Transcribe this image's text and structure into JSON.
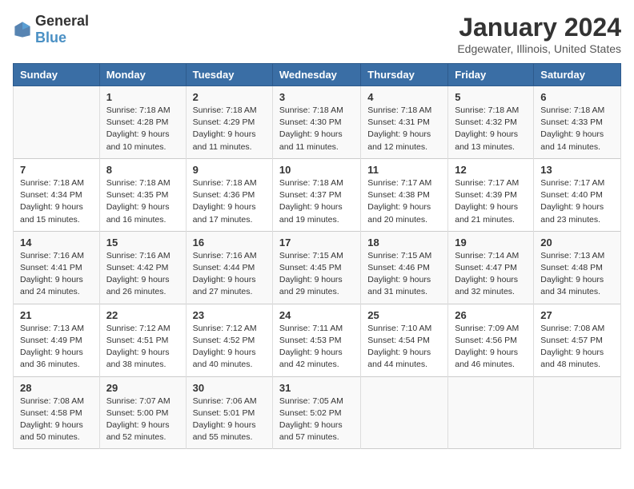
{
  "header": {
    "logo_general": "General",
    "logo_blue": "Blue",
    "title": "January 2024",
    "subtitle": "Edgewater, Illinois, United States"
  },
  "days_of_week": [
    "Sunday",
    "Monday",
    "Tuesday",
    "Wednesday",
    "Thursday",
    "Friday",
    "Saturday"
  ],
  "weeks": [
    [
      {
        "day": "",
        "sunrise": "",
        "sunset": "",
        "daylight": ""
      },
      {
        "day": "1",
        "sunrise": "Sunrise: 7:18 AM",
        "sunset": "Sunset: 4:28 PM",
        "daylight": "Daylight: 9 hours and 10 minutes."
      },
      {
        "day": "2",
        "sunrise": "Sunrise: 7:18 AM",
        "sunset": "Sunset: 4:29 PM",
        "daylight": "Daylight: 9 hours and 11 minutes."
      },
      {
        "day": "3",
        "sunrise": "Sunrise: 7:18 AM",
        "sunset": "Sunset: 4:30 PM",
        "daylight": "Daylight: 9 hours and 11 minutes."
      },
      {
        "day": "4",
        "sunrise": "Sunrise: 7:18 AM",
        "sunset": "Sunset: 4:31 PM",
        "daylight": "Daylight: 9 hours and 12 minutes."
      },
      {
        "day": "5",
        "sunrise": "Sunrise: 7:18 AM",
        "sunset": "Sunset: 4:32 PM",
        "daylight": "Daylight: 9 hours and 13 minutes."
      },
      {
        "day": "6",
        "sunrise": "Sunrise: 7:18 AM",
        "sunset": "Sunset: 4:33 PM",
        "daylight": "Daylight: 9 hours and 14 minutes."
      }
    ],
    [
      {
        "day": "7",
        "sunrise": "Sunrise: 7:18 AM",
        "sunset": "Sunset: 4:34 PM",
        "daylight": "Daylight: 9 hours and 15 minutes."
      },
      {
        "day": "8",
        "sunrise": "Sunrise: 7:18 AM",
        "sunset": "Sunset: 4:35 PM",
        "daylight": "Daylight: 9 hours and 16 minutes."
      },
      {
        "day": "9",
        "sunrise": "Sunrise: 7:18 AM",
        "sunset": "Sunset: 4:36 PM",
        "daylight": "Daylight: 9 hours and 17 minutes."
      },
      {
        "day": "10",
        "sunrise": "Sunrise: 7:18 AM",
        "sunset": "Sunset: 4:37 PM",
        "daylight": "Daylight: 9 hours and 19 minutes."
      },
      {
        "day": "11",
        "sunrise": "Sunrise: 7:17 AM",
        "sunset": "Sunset: 4:38 PM",
        "daylight": "Daylight: 9 hours and 20 minutes."
      },
      {
        "day": "12",
        "sunrise": "Sunrise: 7:17 AM",
        "sunset": "Sunset: 4:39 PM",
        "daylight": "Daylight: 9 hours and 21 minutes."
      },
      {
        "day": "13",
        "sunrise": "Sunrise: 7:17 AM",
        "sunset": "Sunset: 4:40 PM",
        "daylight": "Daylight: 9 hours and 23 minutes."
      }
    ],
    [
      {
        "day": "14",
        "sunrise": "Sunrise: 7:16 AM",
        "sunset": "Sunset: 4:41 PM",
        "daylight": "Daylight: 9 hours and 24 minutes."
      },
      {
        "day": "15",
        "sunrise": "Sunrise: 7:16 AM",
        "sunset": "Sunset: 4:42 PM",
        "daylight": "Daylight: 9 hours and 26 minutes."
      },
      {
        "day": "16",
        "sunrise": "Sunrise: 7:16 AM",
        "sunset": "Sunset: 4:44 PM",
        "daylight": "Daylight: 9 hours and 27 minutes."
      },
      {
        "day": "17",
        "sunrise": "Sunrise: 7:15 AM",
        "sunset": "Sunset: 4:45 PM",
        "daylight": "Daylight: 9 hours and 29 minutes."
      },
      {
        "day": "18",
        "sunrise": "Sunrise: 7:15 AM",
        "sunset": "Sunset: 4:46 PM",
        "daylight": "Daylight: 9 hours and 31 minutes."
      },
      {
        "day": "19",
        "sunrise": "Sunrise: 7:14 AM",
        "sunset": "Sunset: 4:47 PM",
        "daylight": "Daylight: 9 hours and 32 minutes."
      },
      {
        "day": "20",
        "sunrise": "Sunrise: 7:13 AM",
        "sunset": "Sunset: 4:48 PM",
        "daylight": "Daylight: 9 hours and 34 minutes."
      }
    ],
    [
      {
        "day": "21",
        "sunrise": "Sunrise: 7:13 AM",
        "sunset": "Sunset: 4:49 PM",
        "daylight": "Daylight: 9 hours and 36 minutes."
      },
      {
        "day": "22",
        "sunrise": "Sunrise: 7:12 AM",
        "sunset": "Sunset: 4:51 PM",
        "daylight": "Daylight: 9 hours and 38 minutes."
      },
      {
        "day": "23",
        "sunrise": "Sunrise: 7:12 AM",
        "sunset": "Sunset: 4:52 PM",
        "daylight": "Daylight: 9 hours and 40 minutes."
      },
      {
        "day": "24",
        "sunrise": "Sunrise: 7:11 AM",
        "sunset": "Sunset: 4:53 PM",
        "daylight": "Daylight: 9 hours and 42 minutes."
      },
      {
        "day": "25",
        "sunrise": "Sunrise: 7:10 AM",
        "sunset": "Sunset: 4:54 PM",
        "daylight": "Daylight: 9 hours and 44 minutes."
      },
      {
        "day": "26",
        "sunrise": "Sunrise: 7:09 AM",
        "sunset": "Sunset: 4:56 PM",
        "daylight": "Daylight: 9 hours and 46 minutes."
      },
      {
        "day": "27",
        "sunrise": "Sunrise: 7:08 AM",
        "sunset": "Sunset: 4:57 PM",
        "daylight": "Daylight: 9 hours and 48 minutes."
      }
    ],
    [
      {
        "day": "28",
        "sunrise": "Sunrise: 7:08 AM",
        "sunset": "Sunset: 4:58 PM",
        "daylight": "Daylight: 9 hours and 50 minutes."
      },
      {
        "day": "29",
        "sunrise": "Sunrise: 7:07 AM",
        "sunset": "Sunset: 5:00 PM",
        "daylight": "Daylight: 9 hours and 52 minutes."
      },
      {
        "day": "30",
        "sunrise": "Sunrise: 7:06 AM",
        "sunset": "Sunset: 5:01 PM",
        "daylight": "Daylight: 9 hours and 55 minutes."
      },
      {
        "day": "31",
        "sunrise": "Sunrise: 7:05 AM",
        "sunset": "Sunset: 5:02 PM",
        "daylight": "Daylight: 9 hours and 57 minutes."
      },
      {
        "day": "",
        "sunrise": "",
        "sunset": "",
        "daylight": ""
      },
      {
        "day": "",
        "sunrise": "",
        "sunset": "",
        "daylight": ""
      },
      {
        "day": "",
        "sunrise": "",
        "sunset": "",
        "daylight": ""
      }
    ]
  ]
}
